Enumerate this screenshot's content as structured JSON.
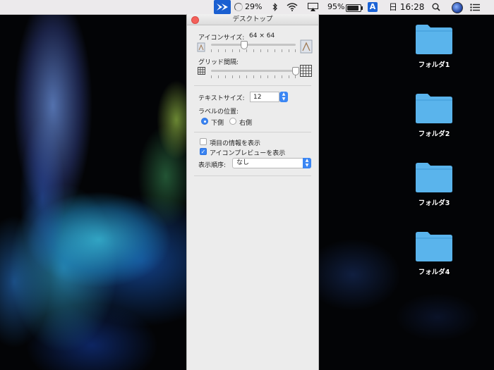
{
  "menubar": {
    "progress_text": "29%",
    "battery_text": "95%",
    "input_source": "A",
    "clock": "日 16:28",
    "icons": [
      "app-icon",
      "progress-ring-icon",
      "bluetooth-icon",
      "wifi-icon",
      "airplay-icon",
      "battery-icon",
      "input-source-icon",
      "search-icon",
      "avatar-icon",
      "list-menu-icon"
    ]
  },
  "panel": {
    "title": "デスクトップ",
    "icon_size": {
      "label": "アイコンサイズ:",
      "value": "64 × 64",
      "slider_fraction": 0.39
    },
    "grid_spacing": {
      "label": "グリッド間隔:",
      "slider_fraction": 1.0
    },
    "text_size": {
      "label": "テキストサイズ:",
      "value": "12"
    },
    "label_position": {
      "label": "ラベルの位置:",
      "options": [
        {
          "label": "下側",
          "selected": true
        },
        {
          "label": "右側",
          "selected": false
        }
      ]
    },
    "show_item_info": {
      "label": "項目の情報を表示",
      "checked": false
    },
    "show_icon_preview": {
      "label": "アイコンプレビューを表示",
      "checked": true
    },
    "sort_by": {
      "label": "表示順序:",
      "value": "なし"
    }
  },
  "desktop": {
    "folder_color": "#5ab4ec",
    "folders": [
      {
        "label": "フォルダ1"
      },
      {
        "label": "フォルダ2"
      },
      {
        "label": "フォルダ3"
      },
      {
        "label": "フォルダ4"
      }
    ]
  }
}
